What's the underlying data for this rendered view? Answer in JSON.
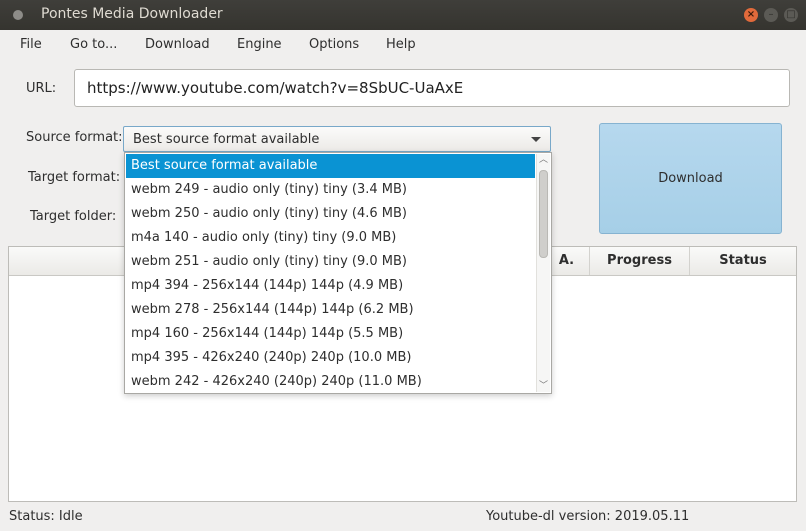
{
  "window": {
    "title": "Pontes Media Downloader",
    "controls": {
      "minimize": "–",
      "maximize": "□",
      "close": "×"
    }
  },
  "menu": [
    "File",
    "Go to...",
    "Download",
    "Engine",
    "Options",
    "Help"
  ],
  "form": {
    "url_label": "URL:",
    "url_value": "https://www.youtube.com/watch?v=8SbUC-UaAxE",
    "source_format_label": "Source format:",
    "source_format_value": "Best source format available",
    "target_format_label": "Target format:",
    "target_folder_label": "Target folder:",
    "download_label": "Download"
  },
  "table": {
    "headers": {
      "partial": "A.",
      "progress": "Progress",
      "status": "Status"
    }
  },
  "dropdown": {
    "items": [
      "Best source format available",
      "webm 249 - audio only (tiny) tiny (3.4 MB)",
      "webm 250 - audio only (tiny) tiny (4.6 MB)",
      "m4a 140 - audio only (tiny) tiny (9.0 MB)",
      "webm 251 - audio only (tiny) tiny (9.0 MB)",
      "mp4 394 - 256x144 (144p) 144p (4.9 MB)",
      "webm 278 - 256x144 (144p) 144p (6.2 MB)",
      "mp4 160 - 256x144 (144p) 144p (5.5 MB)",
      "mp4 395 - 426x240 (240p) 240p (10.0 MB)",
      "webm 242 - 426x240 (240p) 240p (11.0 MB)"
    ],
    "selected_index": 0,
    "scroll_up": "︿",
    "scroll_down": "﹀"
  },
  "status": {
    "left": "Status: Idle",
    "right": "Youtube-dl version: 2019.05.11"
  },
  "colors": {
    "selection": "#0a93d3",
    "titlebar": "#3f3e3a",
    "close_button": "#e16a3b",
    "download_button": "#b6d8ee"
  }
}
